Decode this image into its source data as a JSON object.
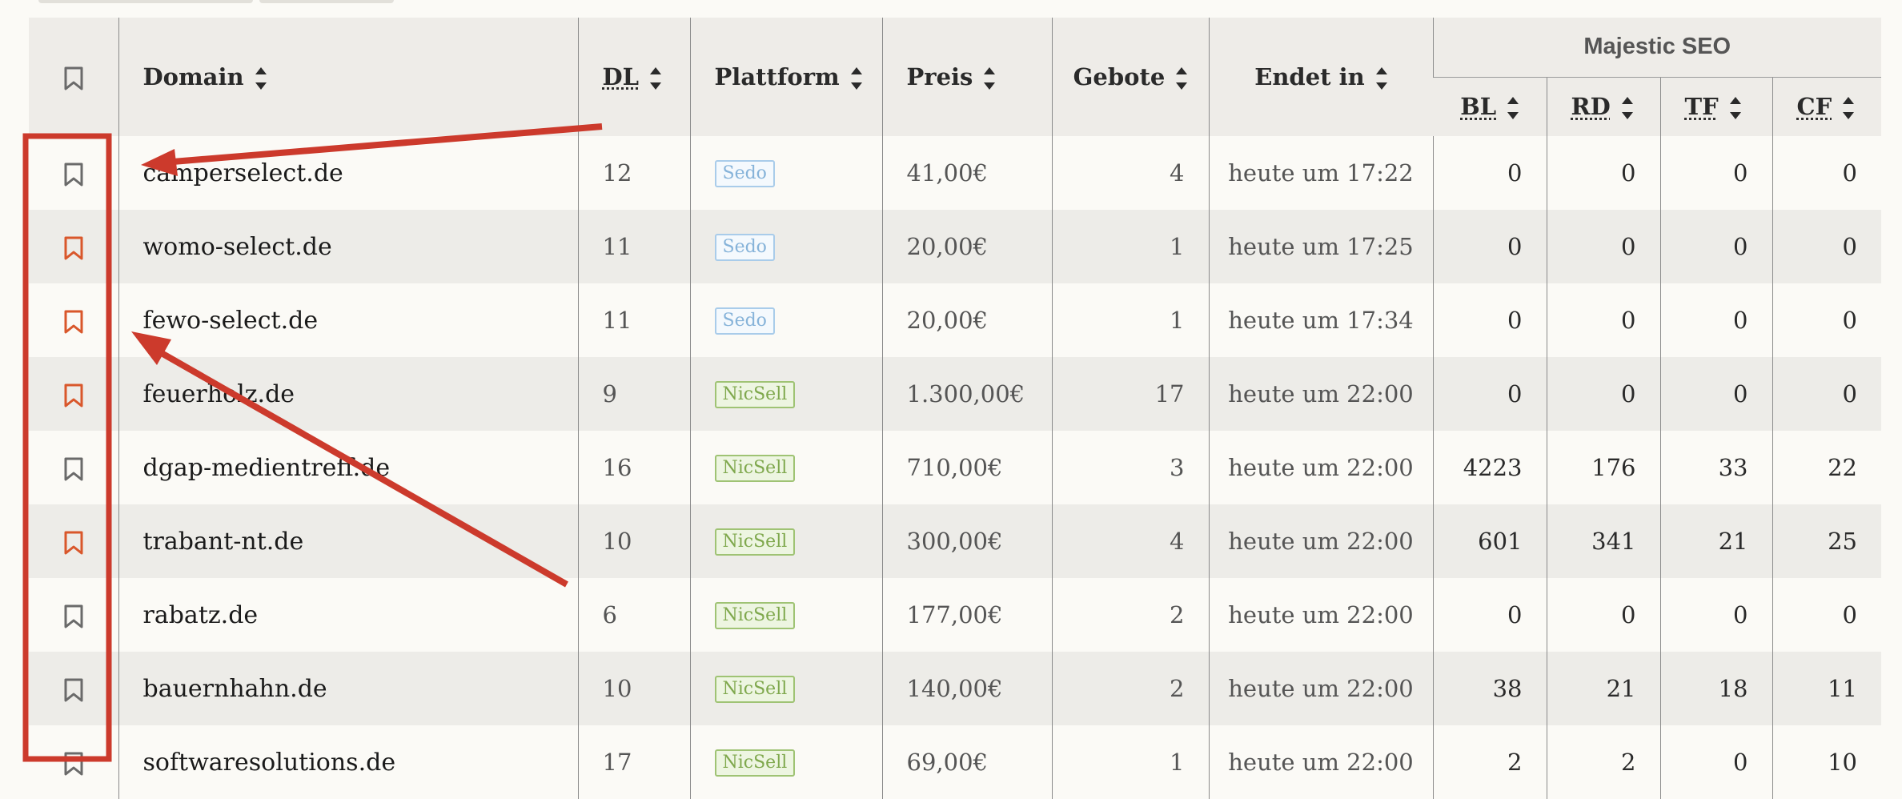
{
  "header": {
    "bookmark_icon": "bookmark-icon",
    "domain": "Domain",
    "dl": "DL",
    "plattform": "Plattform",
    "preis": "Preis",
    "gebote": "Gebote",
    "endet_in": "Endet in",
    "majestic_group": "Majestic SEO",
    "bl": "BL",
    "rd": "RD",
    "tf": "TF",
    "cf": "CF"
  },
  "colors": {
    "bookmark_active": "#d9572b",
    "bookmark_inactive": "#6a6a6a",
    "sedo": "#86b3d9",
    "nicsell": "#7fa84d",
    "annotation": "#cc3a2c"
  },
  "rows": [
    {
      "bookmarked": false,
      "domain": "camperselect.de",
      "dl": "12",
      "platform": "Sedo",
      "price": "41,00€",
      "bids": "4",
      "ends": "heute um 17:22",
      "bl": "0",
      "rd": "0",
      "tf": "0",
      "cf": "0"
    },
    {
      "bookmarked": true,
      "domain": "womo-select.de",
      "dl": "11",
      "platform": "Sedo",
      "price": "20,00€",
      "bids": "1",
      "ends": "heute um 17:25",
      "bl": "0",
      "rd": "0",
      "tf": "0",
      "cf": "0"
    },
    {
      "bookmarked": true,
      "domain": "fewo-select.de",
      "dl": "11",
      "platform": "Sedo",
      "price": "20,00€",
      "bids": "1",
      "ends": "heute um 17:34",
      "bl": "0",
      "rd": "0",
      "tf": "0",
      "cf": "0"
    },
    {
      "bookmarked": true,
      "domain": "feuerholz.de",
      "dl": "9",
      "platform": "NicSell",
      "price": "1.300,00€",
      "bids": "17",
      "ends": "heute um 22:00",
      "bl": "0",
      "rd": "0",
      "tf": "0",
      "cf": "0"
    },
    {
      "bookmarked": false,
      "domain": "dgap-medientreff.de",
      "dl": "16",
      "platform": "NicSell",
      "price": "710,00€",
      "bids": "3",
      "ends": "heute um 22:00",
      "bl": "4223",
      "rd": "176",
      "tf": "33",
      "cf": "22"
    },
    {
      "bookmarked": true,
      "domain": "trabant-nt.de",
      "dl": "10",
      "platform": "NicSell",
      "price": "300,00€",
      "bids": "4",
      "ends": "heute um 22:00",
      "bl": "601",
      "rd": "341",
      "tf": "21",
      "cf": "25"
    },
    {
      "bookmarked": false,
      "domain": "rabatz.de",
      "dl": "6",
      "platform": "NicSell",
      "price": "177,00€",
      "bids": "2",
      "ends": "heute um 22:00",
      "bl": "0",
      "rd": "0",
      "tf": "0",
      "cf": "0"
    },
    {
      "bookmarked": false,
      "domain": "bauernhahn.de",
      "dl": "10",
      "platform": "NicSell",
      "price": "140,00€",
      "bids": "2",
      "ends": "heute um 22:00",
      "bl": "38",
      "rd": "21",
      "tf": "18",
      "cf": "11"
    },
    {
      "bookmarked": false,
      "domain": "softwaresolutions.de",
      "dl": "17",
      "platform": "NicSell",
      "price": "69,00€",
      "bids": "1",
      "ends": "heute um 22:00",
      "bl": "2",
      "rd": "2",
      "tf": "0",
      "cf": "10"
    }
  ]
}
